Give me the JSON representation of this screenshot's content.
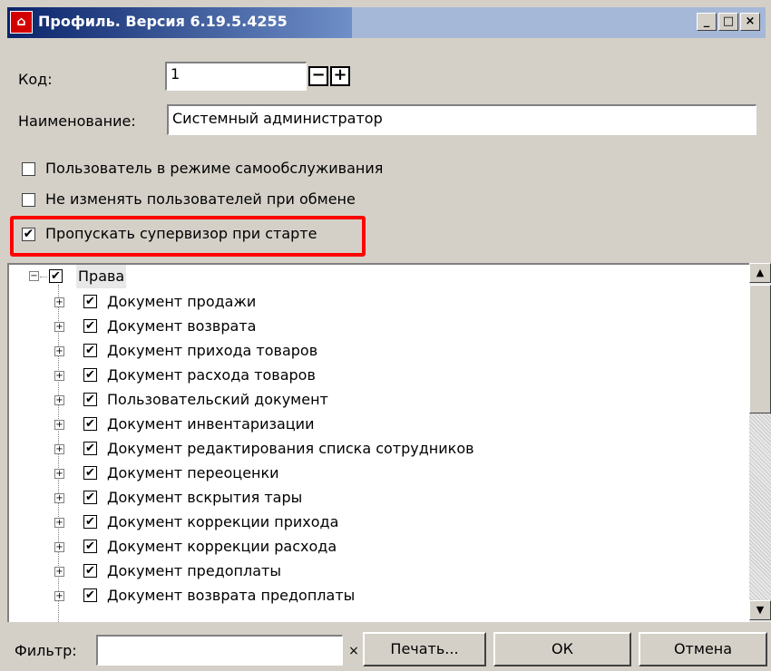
{
  "window": {
    "title": "Профиль. Версия 6.19.5.4255",
    "icon": "user-profile-icon",
    "controls": [
      "minimize-icon",
      "maximize-icon",
      "close-icon"
    ]
  },
  "form": {
    "code_label": "Код:",
    "code_value": "1",
    "decrement_label": "−",
    "increment_label": "+",
    "name_label": "Наименование:",
    "name_value": "Системный администратор"
  },
  "options": [
    {
      "label": "Пользователь в режиме самообслуживания",
      "checked": false
    },
    {
      "label": "Не изменять пользователей при обмене",
      "checked": false
    },
    {
      "label": "Пропускать супервизор при старте",
      "checked": true
    }
  ],
  "highlight_color": "#ff0000",
  "tree": {
    "root": {
      "label": "Права",
      "checked": true,
      "expanded": true
    },
    "children": [
      {
        "label": "Документ продажи",
        "checked": true
      },
      {
        "label": "Документ возврата",
        "checked": true
      },
      {
        "label": "Документ прихода товаров",
        "checked": true
      },
      {
        "label": "Документ расхода товаров",
        "checked": true
      },
      {
        "label": "Пользовательский документ",
        "checked": true
      },
      {
        "label": "Документ инвентаризации",
        "checked": true
      },
      {
        "label": "Документ редактирования списка сотрудников",
        "checked": true
      },
      {
        "label": "Документ переоценки",
        "checked": true
      },
      {
        "label": "Документ вскрытия тары",
        "checked": true
      },
      {
        "label": "Документ коррекции прихода",
        "checked": true
      },
      {
        "label": "Документ коррекции расхода",
        "checked": true
      },
      {
        "label": "Документ предоплаты",
        "checked": true
      },
      {
        "label": "Документ возврата предоплаты",
        "checked": true
      }
    ]
  },
  "footer": {
    "filter_label": "Фильтр:",
    "filter_value": "",
    "clear_filter_label": "×",
    "print_label": "Печать...",
    "ok_label": "ОК",
    "cancel_label": "Отмена"
  }
}
